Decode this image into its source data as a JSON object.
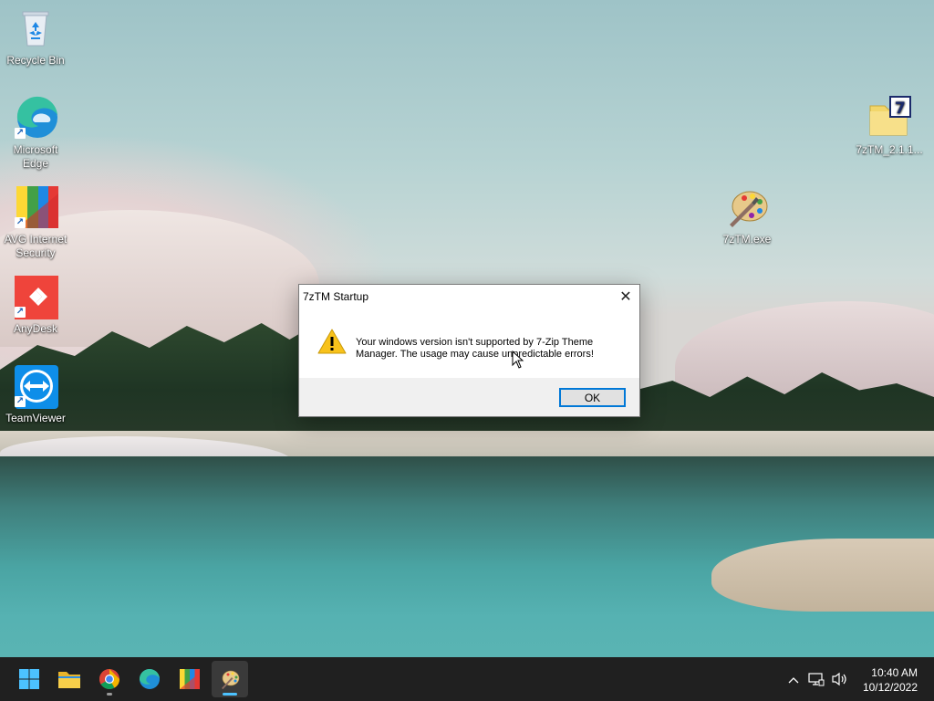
{
  "desktop": {
    "icons": [
      {
        "label": "Recycle Bin"
      },
      {
        "label": "Microsoft Edge"
      },
      {
        "label": "AVG Internet Security"
      },
      {
        "label": "AnyDesk"
      },
      {
        "label": "TeamViewer"
      },
      {
        "label": "7zTM_2.1.1..."
      },
      {
        "label": "7zTM.exe"
      }
    ]
  },
  "dialog": {
    "title": "7zTM Startup",
    "close_symbol": "✕",
    "message": "Your windows version isn't supported by 7-Zip Theme\nManager. The usage may cause unpredictable errors!",
    "ok_label": "OK",
    "icon": "warning-icon"
  },
  "taskbar": {
    "items": [
      {
        "name": "start",
        "icon": "windows-logo-icon",
        "active": false
      },
      {
        "name": "file-explorer",
        "icon": "folder-icon",
        "active": false
      },
      {
        "name": "chrome",
        "icon": "chrome-icon",
        "active": false,
        "running": true
      },
      {
        "name": "edge",
        "icon": "edge-icon",
        "active": false
      },
      {
        "name": "avg",
        "icon": "avg-icon",
        "active": false
      },
      {
        "name": "7ztm",
        "icon": "palette-icon",
        "active": true
      }
    ],
    "tray": {
      "chevron": "^",
      "network_icon": "network-icon",
      "volume_icon": "volume-icon"
    },
    "clock": {
      "time": "10:40 AM",
      "date": "10/12/2022"
    }
  },
  "colors": {
    "taskbar_bg": "#202020",
    "accent": "#0078d7",
    "active_indicator": "#4cc2ff"
  }
}
